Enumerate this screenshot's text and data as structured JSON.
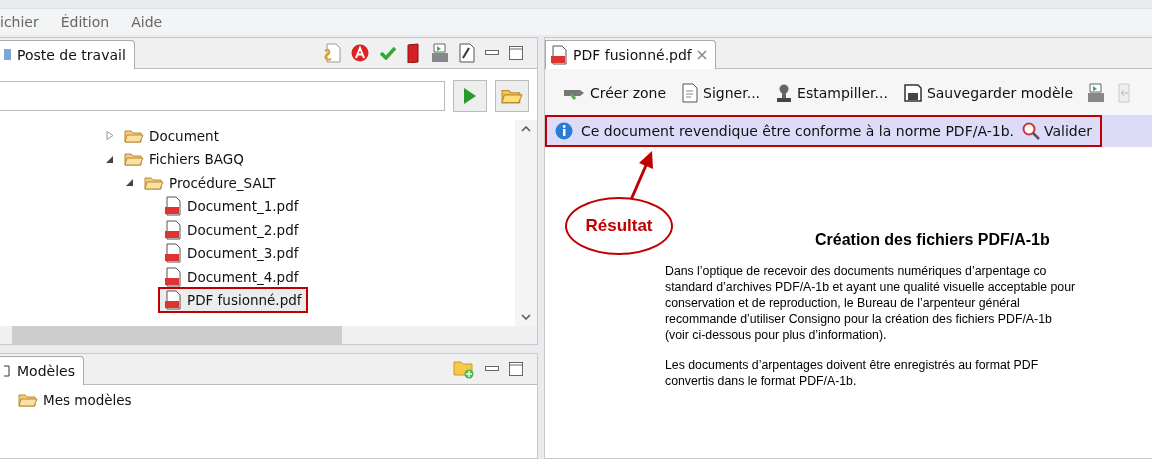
{
  "menu": [
    "ichier",
    "Édition",
    "Aide"
  ],
  "workspace": {
    "tab": {
      "label": "Poste de travail",
      "selected": true
    },
    "tree": [
      {
        "label": "Document",
        "kind": "folder",
        "expanded": false,
        "selected": false
      },
      {
        "label": "Fichiers BAGQ",
        "kind": "folder",
        "expanded": true,
        "selected": false,
        "children": [
          {
            "label": "Procédure_SALT",
            "kind": "folder",
            "expanded": true,
            "selected": false,
            "children": [
              {
                "label": "Document_1.pdf",
                "kind": "pdf",
                "selected": false,
                "annotated": false
              },
              {
                "label": "Document_2.pdf",
                "kind": "pdf",
                "selected": false,
                "annotated": false
              },
              {
                "label": "Document_3.pdf",
                "kind": "pdf",
                "selected": false,
                "annotated": false
              },
              {
                "label": "Document_4.pdf",
                "kind": "pdf",
                "selected": false,
                "annotated": false
              },
              {
                "label": "PDF fusionné.pdf",
                "kind": "pdf",
                "selected": true,
                "annotated": true
              }
            ]
          }
        ]
      }
    ]
  },
  "models": {
    "tab": {
      "label": "Modèles",
      "selected": true
    },
    "items": [
      "Mes modèles"
    ]
  },
  "editor": {
    "tab": {
      "label": "PDF fusionné.pdf",
      "selected": true
    },
    "toolbar": [
      {
        "label": "Créer zone",
        "kind": "zone"
      },
      {
        "label": "Signer...",
        "kind": "sign"
      },
      {
        "label": "Estampiller...",
        "kind": "stamp"
      },
      {
        "label": "Sauvegarder modèle",
        "kind": "save"
      }
    ],
    "info": {
      "message": "Ce document revendique être conforme à la norme PDF/A-1b.",
      "action": "Valider",
      "annotated": true
    },
    "callout": "Résultat",
    "document": {
      "title": "Création des fichiers PDF/A-1b",
      "paragraphs": [
        [
          "Dans l’optique de recevoir des documents numériques d’arpentage co",
          "standard d’archives PDF/A-1b et ayant une qualité visuelle acceptable pour",
          "conservation et de reproduction, le Bureau de l’arpenteur général",
          "recommande d’utiliser Consigno pour la création des fichiers PDF/A-1b",
          "(voir ci-dessous pour plus d’information)."
        ],
        [
          "Les documents d’arpentages doivent être enregistrés au format PDF",
          "convertis dans le format PDF/A-1b."
        ]
      ]
    }
  }
}
